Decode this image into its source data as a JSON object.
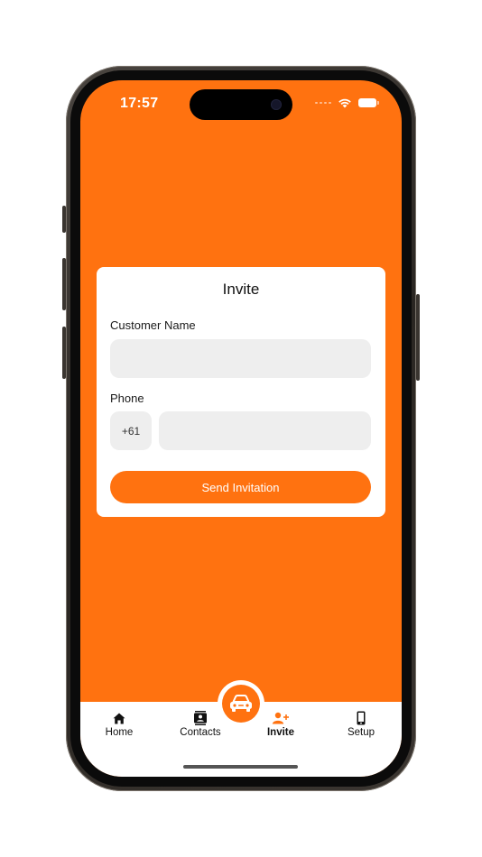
{
  "status_bar": {
    "time": "17:57"
  },
  "invite_card": {
    "title": "Invite",
    "customer_name_label": "Customer Name",
    "customer_name_value": "",
    "phone_label": "Phone",
    "phone_prefix": "+61",
    "phone_value": "",
    "send_button_label": "Send Invitation"
  },
  "tab_bar": {
    "items": [
      {
        "label": "Home",
        "icon": "home-icon",
        "active": false
      },
      {
        "label": "Contacts",
        "icon": "contacts-icon",
        "active": false
      },
      {
        "label": "Invite",
        "icon": "add-user-icon",
        "active": true
      },
      {
        "label": "Setup",
        "icon": "phone-device-icon",
        "active": false
      }
    ],
    "center_button_icon": "car-icon"
  },
  "colors": {
    "accent": "#ff7210",
    "card_background": "#ffffff",
    "input_background": "#eeeeee"
  }
}
